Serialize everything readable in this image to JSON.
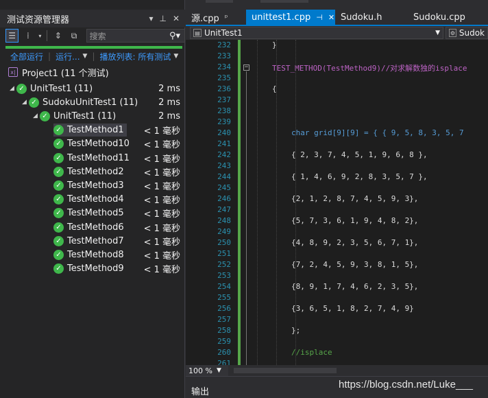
{
  "explorer": {
    "title": "测试资源管理器",
    "search_placeholder": "搜索",
    "actions": {
      "run_all": "全部运行",
      "run": "运行...",
      "playlist": "播放列表: 所有测试"
    },
    "progress_percent": 100,
    "tree": [
      {
        "label": "Project1 (11 个测试)",
        "time": "",
        "level": 0,
        "icon": "project-icon",
        "expanded": null
      },
      {
        "label": "UnitTest1 (11)",
        "time": "2 ms",
        "level": 1,
        "icon": "passed-check-icon",
        "expanded": true
      },
      {
        "label": "SudokuUnitTest1 (11)",
        "time": "2 ms",
        "level": 2,
        "icon": "passed-check-icon",
        "expanded": true
      },
      {
        "label": "UnitTest1 (11)",
        "time": "2 ms",
        "level": 3,
        "icon": "passed-check-icon",
        "expanded": true
      },
      {
        "label": "TestMethod1",
        "time": "< 1 毫秒",
        "level": 4,
        "icon": "passed-check-icon",
        "selected": true
      },
      {
        "label": "TestMethod10",
        "time": "< 1 毫秒",
        "level": 4,
        "icon": "passed-check-icon"
      },
      {
        "label": "TestMethod11",
        "time": "< 1 毫秒",
        "level": 4,
        "icon": "passed-check-icon"
      },
      {
        "label": "TestMethod2",
        "time": "< 1 毫秒",
        "level": 4,
        "icon": "passed-check-icon"
      },
      {
        "label": "TestMethod3",
        "time": "< 1 毫秒",
        "level": 4,
        "icon": "passed-check-icon"
      },
      {
        "label": "TestMethod4",
        "time": "< 1 毫秒",
        "level": 4,
        "icon": "passed-check-icon"
      },
      {
        "label": "TestMethod5",
        "time": "< 1 毫秒",
        "level": 4,
        "icon": "passed-check-icon"
      },
      {
        "label": "TestMethod6",
        "time": "< 1 毫秒",
        "level": 4,
        "icon": "passed-check-icon"
      },
      {
        "label": "TestMethod7",
        "time": "< 1 毫秒",
        "level": 4,
        "icon": "passed-check-icon"
      },
      {
        "label": "TestMethod8",
        "time": "< 1 毫秒",
        "level": 4,
        "icon": "passed-check-icon"
      },
      {
        "label": "TestMethod9",
        "time": "< 1 毫秒",
        "level": 4,
        "icon": "passed-check-icon"
      }
    ]
  },
  "editor": {
    "tabs": [
      {
        "label": "源.cpp",
        "active": false,
        "pinned": true
      },
      {
        "label": "unittest1.cpp",
        "active": true,
        "pinned": true
      },
      {
        "label": "Sudoku.h",
        "active": false,
        "pinned": false
      },
      {
        "label": "Sudoku.cpp",
        "active": false,
        "pinned": false
      }
    ],
    "nav_left": "UnitTest1",
    "nav_right": "Sudok",
    "zoom": "100 %",
    "lines": [
      {
        "num": "232",
        "text": "}"
      },
      {
        "num": "233",
        "text": ""
      },
      {
        "num": "234",
        "text": "TEST_METHOD(TestMethod9)//对求解数独的isplace",
        "fold": true
      },
      {
        "num": "235",
        "text": ""
      },
      {
        "num": "236",
        "text": "{"
      },
      {
        "num": "237",
        "text": ""
      },
      {
        "num": "238",
        "text": ""
      },
      {
        "num": "239",
        "text": ""
      },
      {
        "num": "240",
        "text": "char grid[9][9] = { { 9, 5, 8, 3, 5, 7"
      },
      {
        "num": "241",
        "text": ""
      },
      {
        "num": "242",
        "text": "{ 2, 3, 7, 4, 5, 1, 9, 6, 8 },"
      },
      {
        "num": "243",
        "text": ""
      },
      {
        "num": "244",
        "text": "{ 1, 4, 6, 9, 2, 8, 3, 5, 7 },"
      },
      {
        "num": "245",
        "text": ""
      },
      {
        "num": "246",
        "text": "{2, 1, 2, 8, 7, 4, 5, 9, 3},"
      },
      {
        "num": "247",
        "text": ""
      },
      {
        "num": "248",
        "text": "{5, 7, 3, 6, 1, 9, 4, 8, 2},"
      },
      {
        "num": "249",
        "text": ""
      },
      {
        "num": "250",
        "text": "{4, 8, 9, 2, 3, 5, 6, 7, 1},"
      },
      {
        "num": "251",
        "text": ""
      },
      {
        "num": "252",
        "text": "{7, 2, 4, 5, 9, 3, 8, 1, 5},"
      },
      {
        "num": "253",
        "text": ""
      },
      {
        "num": "254",
        "text": "{8, 9, 1, 7, 4, 6, 2, 3, 5},"
      },
      {
        "num": "255",
        "text": ""
      },
      {
        "num": "256",
        "text": "{3, 6, 5, 1, 8, 2, 7, 4, 9}"
      },
      {
        "num": "257",
        "text": ""
      },
      {
        "num": "258",
        "text": "};"
      },
      {
        "num": "259",
        "text": ""
      },
      {
        "num": "260",
        "text": "//isplace"
      },
      {
        "num": "261",
        "text": ""
      }
    ]
  },
  "output": {
    "label": "输出"
  },
  "watermark": "https://blog.csdn.net/Luke___",
  "colors": {
    "pass_green": "#3fb74b",
    "accent_blue": "#007acc",
    "link_blue": "#3e9bff",
    "line_number": "#2b91af",
    "macro": "#bd63c5",
    "keyword": "#569cd6",
    "comment": "#57a64a"
  }
}
